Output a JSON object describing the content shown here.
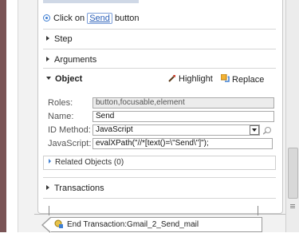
{
  "step": {
    "click_prefix": "Click on",
    "target_link": "Send",
    "click_suffix": "button"
  },
  "sections": {
    "step": "Step",
    "arguments": "Arguments",
    "object": "Object",
    "related_objects": "Related Objects (0)",
    "transactions": "Transactions"
  },
  "object_actions": {
    "highlight": "Highlight",
    "replace": "Replace"
  },
  "object_fields": {
    "roles_label": "Roles:",
    "roles_value": "button,focusable,element",
    "name_label": "Name:",
    "name_value": "Send",
    "id_method_label": "ID Method:",
    "id_method_value": "JavaScript",
    "javascript_label": "JavaScript:",
    "javascript_value": "evalXPath(\"//*[text()=\\\"Send\\\"]\");"
  },
  "end_transaction": "End Transaction:Gmail_2_Send_mail",
  "icons": {
    "step_type": "radio-icon",
    "highlight": "wand-icon",
    "replace": "replace-icon",
    "pick": "target-picker-icon",
    "end_transaction": "transaction-end-icon"
  },
  "colors": {
    "link": "#2a5fb8",
    "left_bar": "#7a5456",
    "accent": "#3f7fd2"
  }
}
